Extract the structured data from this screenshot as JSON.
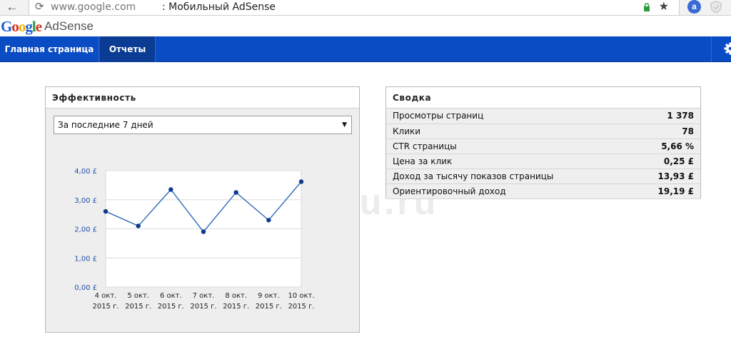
{
  "browser": {
    "url": "www.google.com",
    "page_title": ": Мобильный AdSense",
    "ext_label": "a"
  },
  "logo": {
    "letters": [
      "G",
      "o",
      "o",
      "g",
      "l",
      "e"
    ],
    "product": "AdSense"
  },
  "nav": {
    "home": "Главная страница",
    "reports": "Отчеты"
  },
  "performance": {
    "title": "Эффективность",
    "period": "За последние 7 дней"
  },
  "summary": {
    "title": "Сводка",
    "rows": [
      {
        "label": "Просмотры страниц",
        "value": "1 378"
      },
      {
        "label": "Клики",
        "value": "78"
      },
      {
        "label": "CTR страницы",
        "value": "5,66 %"
      },
      {
        "label": "Цена за клик",
        "value": "0,25 £"
      },
      {
        "label": "Доход за тысячу показов страницы",
        "value": "13,93 £"
      },
      {
        "label": "Ориентировочный доход",
        "value": "19,19 £"
      }
    ]
  },
  "watermark": "au.ru",
  "colors": {
    "nav_bg": "#0a4cc4",
    "nav_active": "#0b3c93",
    "line": "#2f6bb7",
    "point": "#0d3a8c"
  },
  "chart_data": {
    "type": "line",
    "x": [
      "4 окт. 2015 г.",
      "5 окт. 2015 г.",
      "6 окт. 2015 г.",
      "7 окт. 2015 г.",
      "8 окт. 2015 г.",
      "9 окт. 2015 г.",
      "10 окт. 2015 г."
    ],
    "x_lines": [
      [
        "4 окт.",
        "2015 г."
      ],
      [
        "5 окт.",
        "2015 г."
      ],
      [
        "6 окт.",
        "2015 г."
      ],
      [
        "7 окт.",
        "2015 г."
      ],
      [
        "8 окт.",
        "2015 г."
      ],
      [
        "9 окт.",
        "2015 г."
      ],
      [
        "10 окт.",
        "2015 г."
      ]
    ],
    "values": [
      2.6,
      2.1,
      3.35,
      1.9,
      3.25,
      2.3,
      3.62
    ],
    "ylim": [
      0,
      4
    ],
    "yticks": [
      0,
      1,
      2,
      3,
      4
    ],
    "ytick_labels": [
      "0,00 £",
      "1,00 £",
      "2,00 £",
      "3,00 £",
      "4,00 £"
    ],
    "grid": true
  }
}
